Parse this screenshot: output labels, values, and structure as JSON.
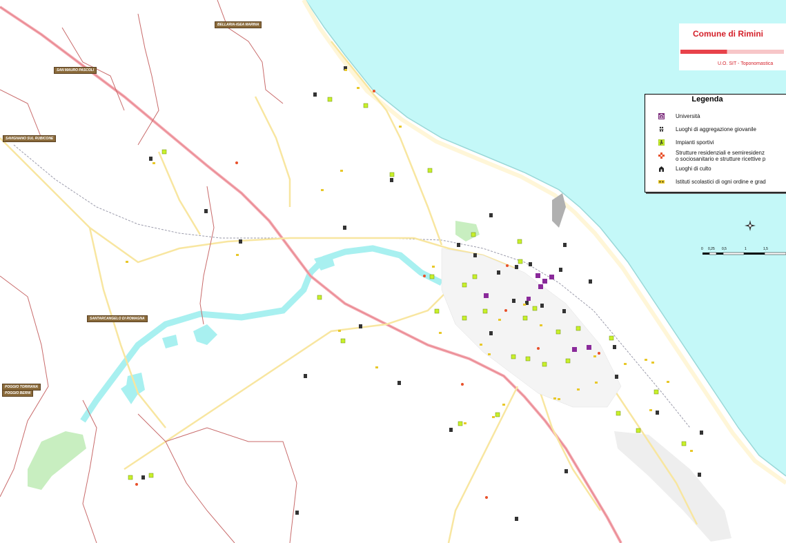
{
  "title": "Comune di Rimini",
  "subtitle": "U.O. SIT - Toponomastica",
  "legend": {
    "title": "Legenda",
    "items": [
      {
        "label": "Università",
        "icon": "university-icon",
        "color": "#7a2a7a"
      },
      {
        "label": "Luoghi di aggregazione giovanile",
        "icon": "youth-center-icon",
        "color": "#222222"
      },
      {
        "label": "Impianti sportivi",
        "icon": "sports-facility-icon",
        "color": "#c8f02a"
      },
      {
        "label": "Strutture residenziali e semiresidenz",
        "label2": "o sociosanitario e strutture ricettive p",
        "icon": "residential-care-icon",
        "color": "#e8502a"
      },
      {
        "label": "Luoghi di culto",
        "icon": "worship-place-icon",
        "color": "#222222"
      },
      {
        "label": "Istituti scolastici di ogni ordine e grad",
        "icon": "school-icon",
        "color": "#e8c82a"
      }
    ]
  },
  "scale": {
    "labels": [
      "0",
      "0,25",
      "0,5",
      "1",
      "1,5"
    ]
  },
  "places": [
    {
      "name": "BELLARIA-IGEA MARINA"
    },
    {
      "name": "SAN MAURO PASCOLI"
    },
    {
      "name": "SAVIGNANO SUL RUBICONE"
    },
    {
      "name": "SANTARCANGELO DI ROMAGNA"
    },
    {
      "name": "POGGIO TORRIANA"
    },
    {
      "name": "POGGIO BERNI"
    }
  ],
  "colors": {
    "sea": "#c4f8f8",
    "river": "#a8f0f0",
    "road": "#f8e6a0",
    "highway": "#f4a8b0",
    "boundary": "#c86a6a",
    "park": "#c8eec0"
  }
}
